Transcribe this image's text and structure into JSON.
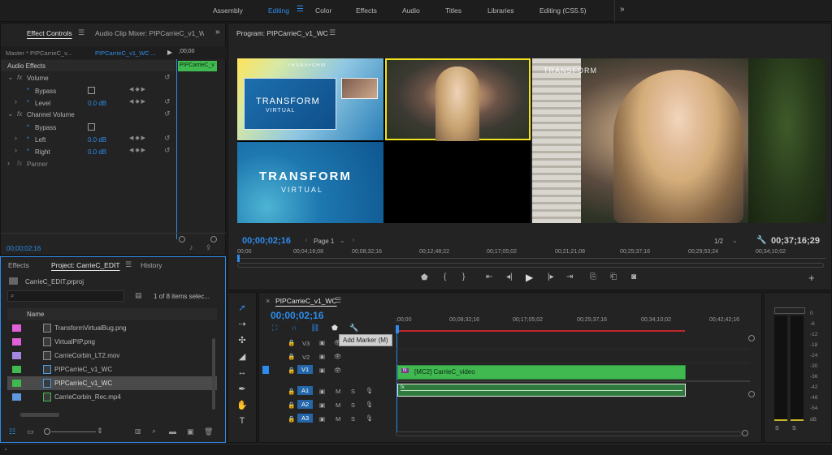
{
  "workspaces": {
    "tabs": [
      "Assembly",
      "Editing",
      "Color",
      "Effects",
      "Audio",
      "Titles",
      "Libraries",
      "Editing (CS5.5)"
    ],
    "active": "Editing",
    "overflow_icon": "double-chevron-right-icon"
  },
  "effect_controls": {
    "tabs": [
      "Effect Controls",
      "Audio Clip Mixer: PIPCarrieC_v1_W("
    ],
    "menu_icon": "menu-icon",
    "master_label": "Master * PIPCarrieC_v...",
    "sequence_label": "PIPCarrieC_v1_WC ...",
    "ruler_time": ";00;00",
    "clip_label": "PIPCarrieC_v",
    "section": "Audio Effects",
    "volume_title": "Volume",
    "bypass_label": "Bypass",
    "level_label": "Level",
    "level_value": "0.0 dB",
    "channel_volume_title": "Channel Volume",
    "left_label": "Left",
    "left_value": "0.0 dB",
    "right_label": "Right",
    "right_value": "0.0 dB",
    "panner_title": "Panner",
    "fx_label": "fx",
    "timecode": "00;00;02;16"
  },
  "program": {
    "title": "Program: PIPCarrieC_v1_WC",
    "menu_icon": "menu-icon",
    "brand_top": "TRANSFORM",
    "brand_bottom": "VIRTUAL",
    "brand_rm": "RM",
    "timecode": "00;00;02;16",
    "page_label": "Page 1",
    "fraction": "1/2",
    "duration": "00;37;16;29",
    "ruler": [
      "00;00",
      "00;04;16;08",
      "00;08;32;16",
      "00;12;48;22",
      "00;17;05;02",
      "00;21;21;08",
      "00;25;37;16",
      "00;29;53;24",
      "00;34;10;02"
    ]
  },
  "project": {
    "tabs": [
      "Effects",
      "Project: CarrieC_EDIT",
      "History"
    ],
    "file": "CarrieC_EDIT.prproj",
    "items_count": "1 of 8 items selec...",
    "name_header": "Name",
    "items": [
      {
        "name": "TransformVirtualBug.png",
        "color": "#e060d8"
      },
      {
        "name": "VirtualPIP.png",
        "color": "#e060d8"
      },
      {
        "name": "CarrieCorbin_LT2.mov",
        "color": "#a488e0"
      },
      {
        "name": "PIPCarrieC_v1_WC",
        "color": "#3fb950"
      },
      {
        "name": "PIPCarrieC_v1_WC",
        "color": "#3fb950",
        "selected": true
      },
      {
        "name": "CarrieCorbin_Rec.mp4",
        "color": "#5f9ae0"
      }
    ]
  },
  "timeline": {
    "tab": "PIPCarrieC_v1_WC",
    "timecode": "00;00;02;16",
    "tooltip": "Add Marker (M)",
    "ruler": [
      ";00;00",
      "00;08;32;16",
      "00;17;05;02",
      "00;25;37;16",
      "00;34;10;02",
      "00;42;42;16"
    ],
    "video_tracks": [
      "V3",
      "V2",
      "V1"
    ],
    "audio_tracks": [
      "A1",
      "A2",
      "A3"
    ],
    "mute": "M",
    "solo": "S",
    "clip_label": "[MC2] CarrieC_video",
    "fx_badge": "fx"
  },
  "meters": {
    "labels": [
      "0",
      "-6",
      "-12",
      "-18",
      "-24",
      "-30",
      "-36",
      "-42",
      "-48",
      "-54"
    ],
    "bottom": "dB",
    "solo": [
      "S",
      "S"
    ]
  },
  "colors": {
    "accent": "#2d8ceb",
    "clip_green": "#3fb950",
    "selection_yellow": "#f2e21f"
  }
}
